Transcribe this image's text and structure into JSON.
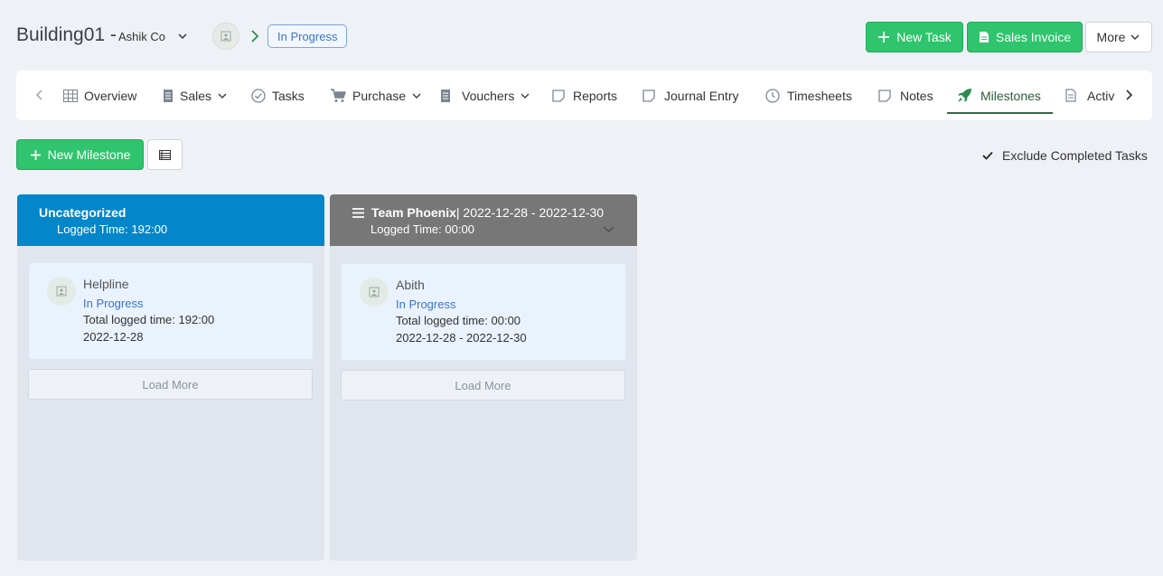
{
  "header": {
    "title": "Building01 -",
    "company": "Ashik Co",
    "status": "In Progress",
    "new_task_label": "New Task",
    "sales_invoice_label": "Sales Invoice",
    "more_label": "More"
  },
  "nav": {
    "items": [
      {
        "label": "Overview",
        "icon": "grid-icon"
      },
      {
        "label": "Sales",
        "icon": "receipt-icon",
        "dropdown": true
      },
      {
        "label": "Tasks",
        "icon": "check-circle-icon"
      },
      {
        "label": "Purchase",
        "icon": "cart-icon",
        "dropdown": true
      },
      {
        "label": "Vouchers",
        "icon": "receipt-icon",
        "dropdown": true
      },
      {
        "label": "Reports",
        "icon": "note-icon"
      },
      {
        "label": "Journal Entry",
        "icon": "note-icon"
      },
      {
        "label": "Timesheets",
        "icon": "clock-icon"
      },
      {
        "label": "Notes",
        "icon": "note-icon"
      },
      {
        "label": "Milestones",
        "icon": "rocket-icon",
        "active": true
      },
      {
        "label": "Activ",
        "icon": "document-icon"
      }
    ]
  },
  "toolbar": {
    "new_milestone_label": "New Milestone",
    "exclude_completed_label": "Exclude Completed Tasks",
    "exclude_completed_checked": true
  },
  "columns": [
    {
      "title": "Uncategorized",
      "title_suffix": "",
      "logged_time": "Logged Time: 192:00",
      "header_color": "#0386ca",
      "cards": [
        {
          "name": "Helpline",
          "status": "In Progress",
          "total": "Total logged time: 192:00",
          "date": "2022-12-28"
        }
      ],
      "load_more_label": "Load More"
    },
    {
      "title": "Team Phoenix",
      "title_suffix": " | 2022-12-28 - 2022-12-30",
      "logged_time": "Logged Time: 00:00",
      "header_color": "#777777",
      "cards": [
        {
          "name": "Abith",
          "status": "In Progress",
          "total": "Total logged time: 00:00",
          "date": "2022-12-28 - 2022-12-30"
        }
      ],
      "load_more_label": "Load More"
    }
  ],
  "colors": {
    "accent_green": "#2fc46d",
    "status_blue": "#3b74c9",
    "active_tab": "#2d6b45"
  }
}
